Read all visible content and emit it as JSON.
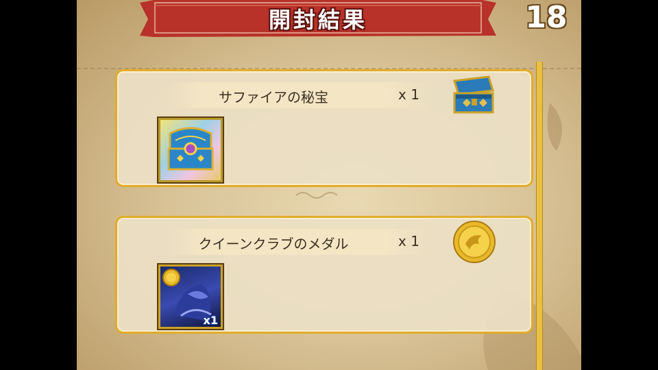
{
  "header": {
    "title": "開封結果",
    "counter": "18"
  },
  "results": [
    {
      "name": "サファイアの秘宝",
      "quantity": "x 1",
      "icon": "treasure-chest-icon"
    },
    {
      "name": "クイーンクラブのメダル",
      "quantity": "x 1",
      "icon": "gold-medal-icon",
      "thumb_quantity": "x1"
    }
  ],
  "colors": {
    "banner_red": "#b8322a",
    "card_border": "#e2ac2b",
    "scroll_track": "#e8c043",
    "parchment": "#d9c498"
  }
}
